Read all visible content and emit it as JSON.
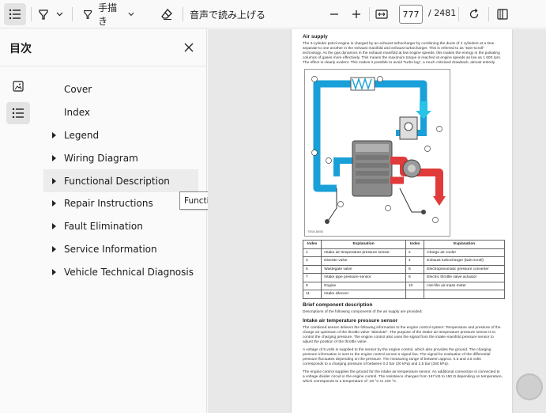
{
  "toolbar": {
    "read_aloud_label": "音声で読み上げる",
    "current_page": "777",
    "total_pages": "/ 2481",
    "draw_label": "手描き"
  },
  "panel": {
    "title": "目次"
  },
  "toc": {
    "items": [
      {
        "label": "Cover",
        "expandable": false
      },
      {
        "label": "Index",
        "expandable": false
      },
      {
        "label": "Legend",
        "expandable": true
      },
      {
        "label": "Wiring Diagram",
        "expandable": true
      },
      {
        "label": "Functional Description",
        "expandable": true
      },
      {
        "label": "Repair Instructions",
        "expandable": true
      },
      {
        "label": "Fault Elimination",
        "expandable": true
      },
      {
        "label": "Service Information",
        "expandable": true
      },
      {
        "label": "Vehicle Technical Diagnosis",
        "expandable": true
      }
    ],
    "tooltip": "Functional Description"
  },
  "doc": {
    "heading1": "Air supply",
    "intro": "The 4-cylinder petrol engine is charged by an exhaust turbocharger by combining the ducts of 2 cylinders at a time separate to one another in the exhaust manifold and exhaust turbocharger. This is referred to as \"twin-scroll\" technology. As the gas dynamics in the exhaust manifold at low engine speeds, this makes the energy in the pulsating columns of gases more effectively. This means the maximum torque is reached at engine speeds as low as 1 600 rpm. The effect is clearly evident. This makes it possible to avoid \"turbo lag\", a much criticised drawback, almost entirely.",
    "figure_label": "TE04-8456",
    "table": {
      "headers": [
        "Index",
        "Explanation",
        "Index",
        "Explanation"
      ],
      "rows": [
        [
          "1",
          "Intake air temperature pressure sensor",
          "2",
          "Charge air cooler"
        ],
        [
          "3",
          "Diverter valve",
          "4",
          "Exhaust turbocharger (twin-scroll)"
        ],
        [
          "5",
          "Wastegate valve",
          "6",
          "Electropneumatic pressure converter"
        ],
        [
          "7",
          "Intake pipe pressure sensor",
          "8",
          "Electric throttle valve actuator"
        ],
        [
          "9",
          "Engine",
          "10",
          "Hot-film air mass meter"
        ],
        [
          "11",
          "Intake silencer",
          "",
          ""
        ]
      ]
    },
    "heading2": "Brief component description",
    "para2": "Descriptions of the following components of the air supply are provided:",
    "heading3": "Intake air temperature pressure sensor",
    "para3": "The combined sensor delivers the following information to the engine control system: Temperature and pressure of the charge air upstream of the throttle valve \"absolute\". The purpose of the intake air temperature pressure sensor is to control the charging pressure. The engine control also uses the signal from the intake-manifold pressure sensor to adjust the position of the throttle valve.",
    "para4": "A voltage of 5 volts is supplied to the sensor by the engine control, which also provides the ground. The charging pressure information is sent to the engine control across a signal line. The signal for evaluation of the differential pressure fluctuates depending on the pressure. The measuring range of between approx. 0.5 and 4.5 volts corresponds to a charging pressure of between 0.2 bar (20 kPa) and 2.5 bar (250 kPa).",
    "para5": "The engine control supplies the ground for the intake air temperature sensor. An additional connection is connected to a voltage divider circuit in the engine control. The resistance changes from 167 kΩ to 150 Ω depending on temperature, which corresponds to a temperature of -40 °C to 130 °C."
  },
  "colors": {
    "pipe_blue": "#1aa0d8",
    "pipe_red": "#e03a3a",
    "accent": "#0067c0"
  }
}
